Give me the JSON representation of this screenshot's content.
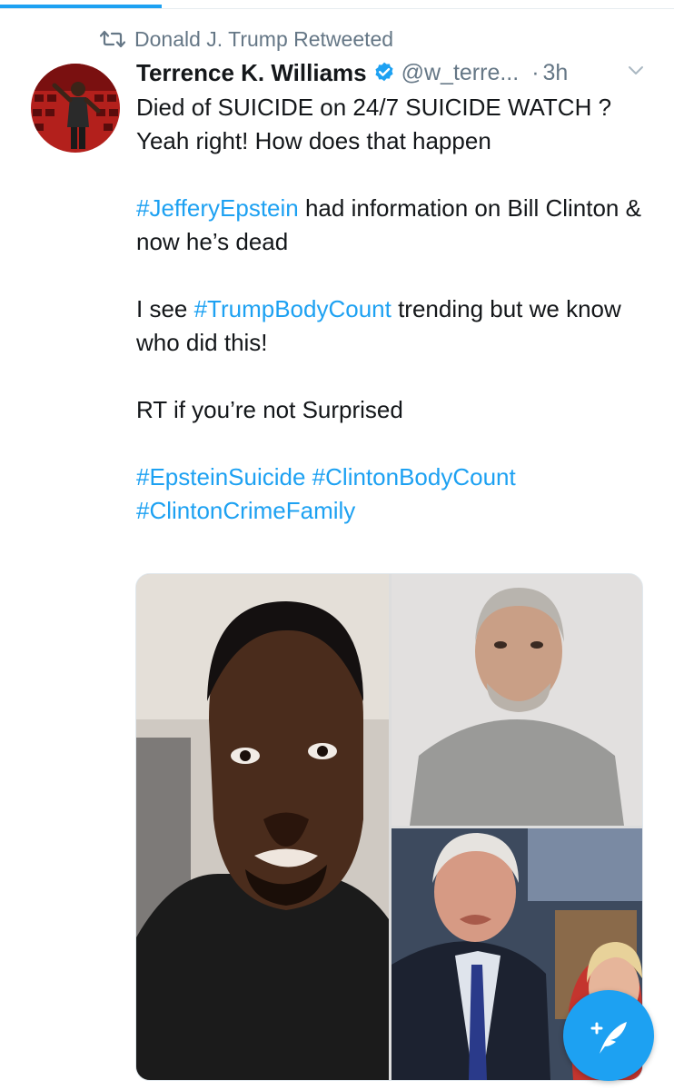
{
  "retweet_banner": {
    "text": "Donald J. Trump Retweeted",
    "icon": "retweet-icon"
  },
  "tweet": {
    "display_name": "Terrence K. Williams",
    "verified_icon": "verified-badge-icon",
    "handle": "@w_terre...",
    "separator": "·",
    "time": "3h",
    "menu_icon": "chevron-down-icon",
    "text": {
      "p1": "Died of SUICIDE on 24/7 SUICIDE WATCH ? Yeah right! How does that happen",
      "p2_tag": "#JefferyEpstein",
      "p2_rest": " had information on Bill Clinton & now he’s dead",
      "p3_pre": "I see ",
      "p3_tag": "#TrumpBodyCount",
      "p3_rest": " trending but we know who did this!",
      "p4": "RT if you’re not Surprised",
      "tags_line1": "#EpsteinSuicide #ClintonBodyCount",
      "tags_line2": "#ClintonCrimeFamily"
    },
    "media": [
      "photo-man-selfie",
      "photo-mugshot",
      "photo-bill-hillary"
    ]
  },
  "compose_button": {
    "icon": "compose-tweet-icon"
  },
  "colors": {
    "accent": "#1da1f2",
    "text": "#14171a",
    "muted": "#657786"
  }
}
